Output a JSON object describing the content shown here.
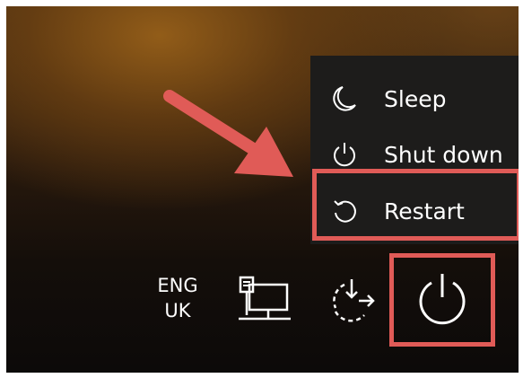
{
  "power_menu": {
    "items": [
      {
        "label": "Sleep",
        "icon": "moon-icon"
      },
      {
        "label": "Shut down",
        "icon": "power-icon"
      },
      {
        "label": "Restart",
        "icon": "restart-icon"
      }
    ]
  },
  "status": {
    "language_line1": "ENG",
    "language_line2": "UK"
  },
  "icons": {
    "network": "network-icon",
    "accessibility": "accessibility-icon",
    "power": "power-icon",
    "annotation_arrow": "arrow-icon"
  },
  "colors": {
    "highlight": "#e05b57",
    "menu_background": "#1d1c1b",
    "text": "#ffffff"
  }
}
